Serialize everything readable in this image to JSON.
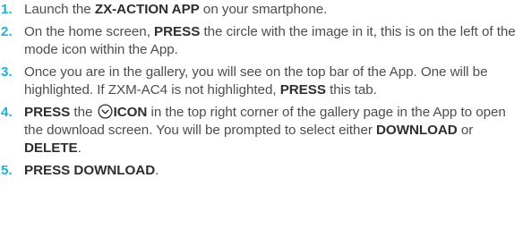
{
  "steps": [
    {
      "number": "1.",
      "pre": "Launch the ",
      "bold1": "ZX-ACTION APP",
      "post": " on your smartphone."
    },
    {
      "number": "2.",
      "pre": "On the home screen, ",
      "bold1": "PRESS",
      "post": " the circle with the image in it, this is on the left of the mode icon within the App."
    },
    {
      "number": "3.",
      "pre": "Once you are in the gallery, you will see on the top bar of the App. One will be highlighted. If ZXM-AC4 is not highlighted, ",
      "bold1": "PRESS",
      "post": " this tab."
    },
    {
      "number": "4.",
      "bold1": "PRESS",
      "mid1": " the ",
      "icon": "check-circle-icon",
      "bold2": "ICON",
      "mid2": " in the top right corner of the gallery page in the App to open the download screen. You will be prompted to select either ",
      "bold3": "DOWNLOAD",
      "mid3": " or ",
      "bold4": "DELETE",
      "post": "."
    },
    {
      "number": "5.",
      "bold1": "PRESS DOWNLOAD",
      "post": "."
    }
  ],
  "colors": {
    "number": "#1cb3d6",
    "text": "#4d4d4d",
    "bold": "#2e2e2e"
  }
}
